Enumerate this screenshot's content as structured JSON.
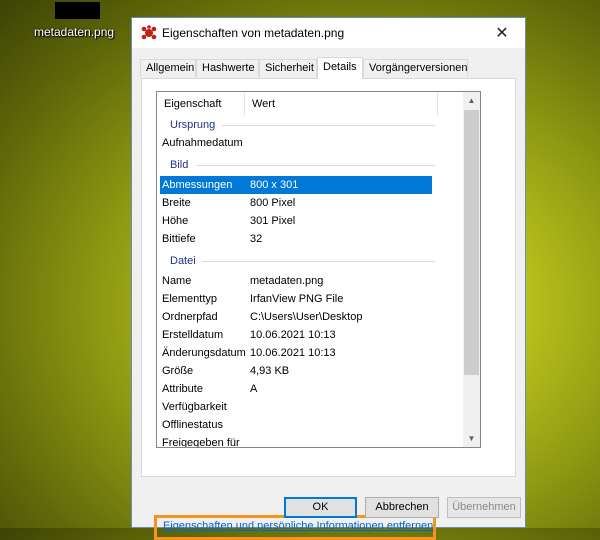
{
  "desktop": {
    "file_label": "metadaten.png"
  },
  "dialog": {
    "title": "Eigenschaften von metadaten.png",
    "close_glyph": "✕",
    "tabs": [
      {
        "label": "Allgemein"
      },
      {
        "label": "Hashwerte"
      },
      {
        "label": "Sicherheit"
      },
      {
        "label": "Details",
        "active": true
      },
      {
        "label": "Vorgängerversionen"
      }
    ],
    "list": {
      "col_property": "Eigenschaft",
      "col_value": "Wert",
      "groups": {
        "origin": "Ursprung",
        "image": "Bild",
        "file": "Datei"
      },
      "rows": {
        "capture_date": {
          "key": "Aufnahmedatum",
          "value": ""
        },
        "dimensions": {
          "key": "Abmessungen",
          "value": "800 x 301"
        },
        "width": {
          "key": "Breite",
          "value": "800 Pixel"
        },
        "height": {
          "key": "Höhe",
          "value": "301 Pixel"
        },
        "bit_depth": {
          "key": "Bittiefe",
          "value": "32"
        },
        "name": {
          "key": "Name",
          "value": "metadaten.png"
        },
        "item_type": {
          "key": "Elementtyp",
          "value": "IrfanView PNG File"
        },
        "folder_path": {
          "key": "Ordnerpfad",
          "value": "C:\\Users\\User\\Desktop"
        },
        "created": {
          "key": "Erstelldatum",
          "value": "10.06.2021 10:13"
        },
        "modified": {
          "key": "Änderungsdatum",
          "value": "10.06.2021 10:13"
        },
        "size": {
          "key": "Größe",
          "value": "4,93 KB"
        },
        "attributes": {
          "key": "Attribute",
          "value": "A"
        },
        "availability": {
          "key": "Verfügbarkeit",
          "value": ""
        },
        "offline_status": {
          "key": "Offlinestatus",
          "value": ""
        },
        "shared_with": {
          "key": "Freigegeben für",
          "value": ""
        }
      }
    },
    "remove_link": "Eigenschaften und persönliche Informationen entfernen",
    "buttons": {
      "ok": "OK",
      "cancel": "Abbrechen",
      "apply": "Übernehmen"
    }
  },
  "colors": {
    "selection": "#0078d7",
    "highlight_border": "#f7941d",
    "link": "#0066cc",
    "group_label": "#1e3287"
  }
}
